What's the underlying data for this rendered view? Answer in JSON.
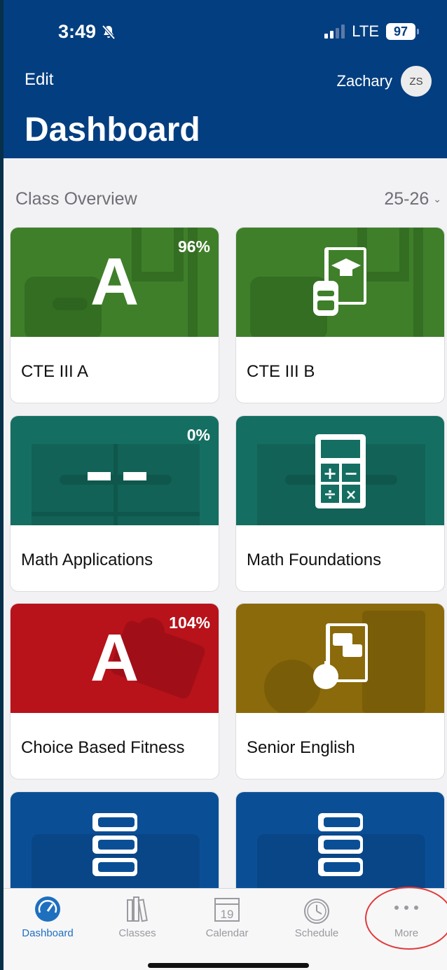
{
  "status": {
    "time": "3:49",
    "network": "LTE",
    "battery": "97"
  },
  "header": {
    "edit_label": "Edit",
    "user_name": "Zachary",
    "avatar_initials": "ZS",
    "title": "Dashboard"
  },
  "section": {
    "label": "Class Overview",
    "year": "25-26"
  },
  "classes": [
    {
      "name": "CTE III A",
      "grade": "A",
      "percent": "96%",
      "color": "#3f7f2a"
    },
    {
      "name": "CTE III B",
      "grade": "",
      "percent": "",
      "color": "#3f7f2a",
      "icon": "book-graduation-icon"
    },
    {
      "name": "Math Applications",
      "grade": "--",
      "percent": "0%",
      "color": "#156e62"
    },
    {
      "name": "Math Foundations",
      "grade": "",
      "percent": "",
      "color": "#156e62",
      "icon": "calculator-icon"
    },
    {
      "name": "Choice Based Fitness",
      "grade": "A",
      "percent": "104%",
      "color": "#b8121a"
    },
    {
      "name": "Senior English",
      "grade": "",
      "percent": "",
      "color": "#8a6a0a",
      "icon": "book-apple-icon"
    },
    {
      "name": "",
      "grade": "",
      "percent": "",
      "color": "#0a4f96",
      "icon": "stacked-books-icon"
    },
    {
      "name": "",
      "grade": "",
      "percent": "",
      "color": "#0a4f96",
      "icon": "stacked-books-icon"
    }
  ],
  "tabs": [
    {
      "label": "Dashboard",
      "icon": "speedometer-icon",
      "active": true
    },
    {
      "label": "Classes",
      "icon": "books-icon",
      "active": false
    },
    {
      "label": "Calendar",
      "icon": "calendar-icon",
      "active": false,
      "day": "19"
    },
    {
      "label": "Schedule",
      "icon": "clock-icon",
      "active": false
    },
    {
      "label": "More",
      "icon": "ellipsis-icon",
      "active": false
    }
  ],
  "colors": {
    "header": "#033e80",
    "accent": "#1f6fbf",
    "annotation": "#e23a3a"
  }
}
